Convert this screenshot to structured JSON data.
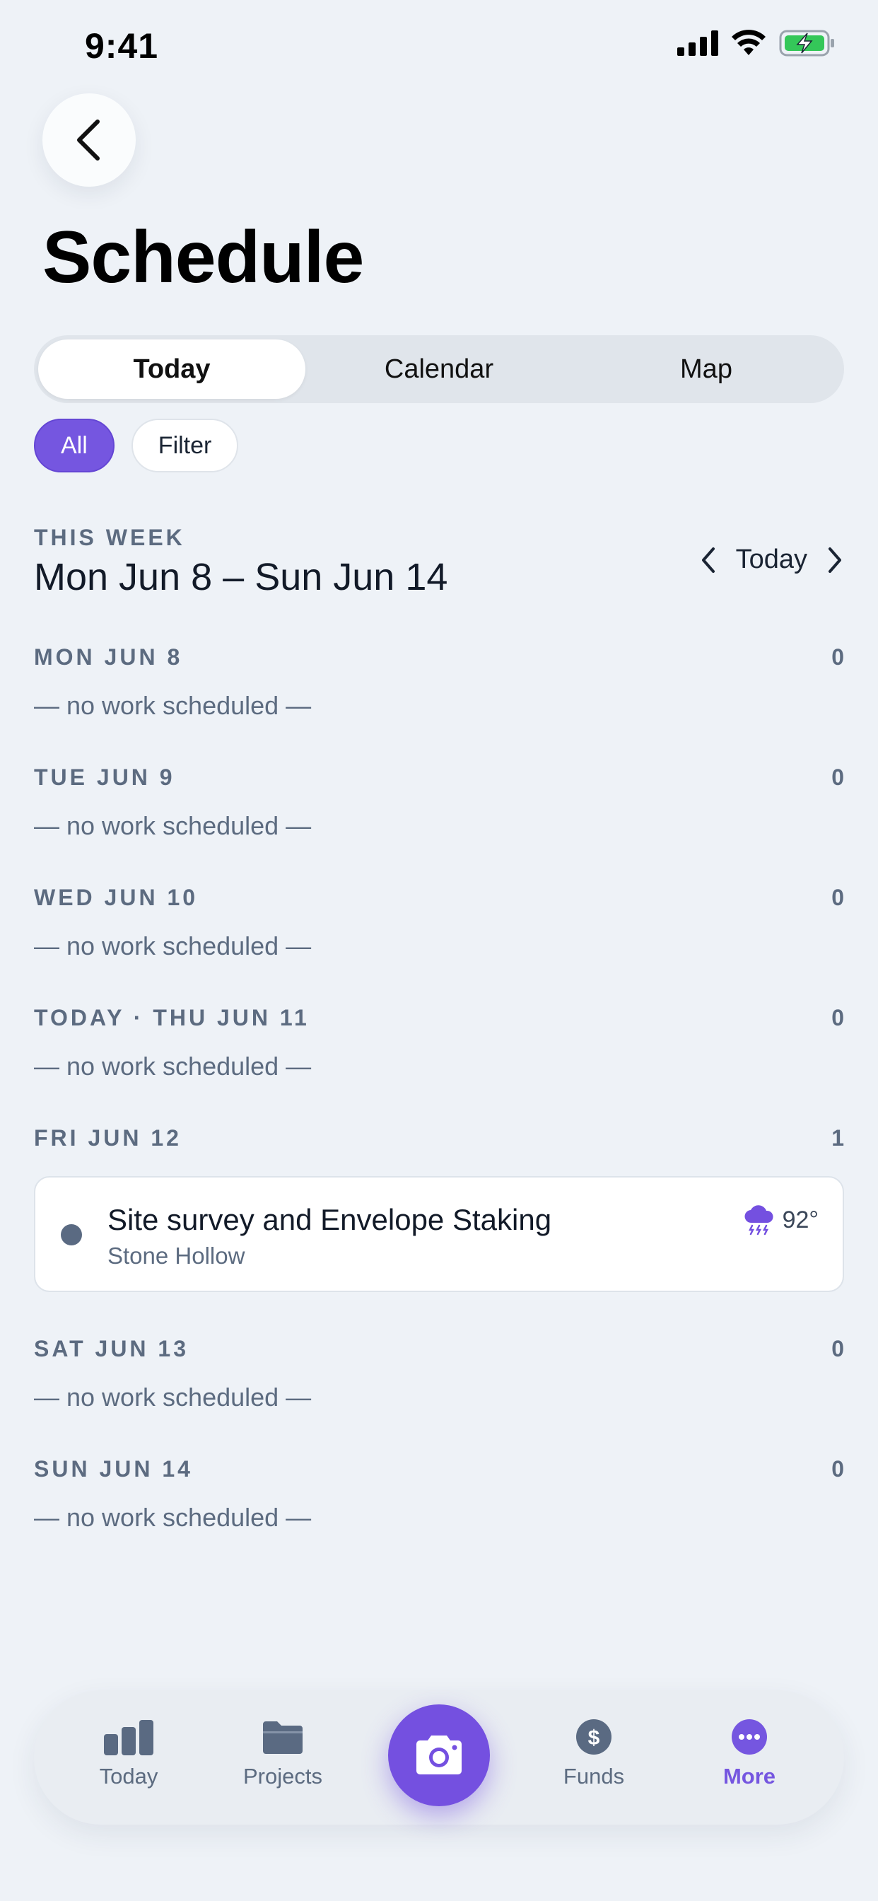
{
  "status_bar": {
    "time": "9:41"
  },
  "header": {
    "title": "Schedule"
  },
  "segments": [
    {
      "label": "Today",
      "active": true
    },
    {
      "label": "Calendar",
      "active": false
    },
    {
      "label": "Map",
      "active": false
    }
  ],
  "chips": [
    {
      "label": "All",
      "active": true
    },
    {
      "label": "Filter",
      "active": false
    }
  ],
  "week": {
    "label": "THIS WEEK",
    "range": "Mon Jun 8 – Sun Jun 14",
    "nav_today": "Today"
  },
  "days": [
    {
      "name": "MON JUN 8",
      "count": "0",
      "empty_text": "— no work scheduled —"
    },
    {
      "name": "TUE JUN 9",
      "count": "0",
      "empty_text": "— no work scheduled —"
    },
    {
      "name": "WED JUN 10",
      "count": "0",
      "empty_text": "— no work scheduled —"
    },
    {
      "name": "TODAY · THU JUN 11",
      "count": "0",
      "empty_text": "— no work scheduled —"
    },
    {
      "name": "FRI JUN 12",
      "count": "1",
      "task": {
        "title": "Site survey and Envelope Staking",
        "project": "Stone Hollow",
        "temp": "92°",
        "weather_icon": "thunderstorm-icon"
      }
    },
    {
      "name": "SAT JUN 13",
      "count": "0",
      "empty_text": "— no work scheduled —"
    },
    {
      "name": "SUN JUN 14",
      "count": "0",
      "empty_text": "— no work scheduled —"
    }
  ],
  "tabbar": {
    "items": [
      {
        "label": "Today",
        "icon": "bar-chart-icon",
        "active": false
      },
      {
        "label": "Projects",
        "icon": "folder-icon",
        "active": false
      },
      {
        "label": "Funds",
        "icon": "dollar-icon",
        "active": false
      },
      {
        "label": "More",
        "icon": "more-icon",
        "active": true
      }
    ],
    "camera_icon": "camera-icon"
  },
  "colors": {
    "accent": "#7556e0",
    "background": "#eef2f7",
    "muted_text": "#5c6b80",
    "battery": "#34c759"
  }
}
